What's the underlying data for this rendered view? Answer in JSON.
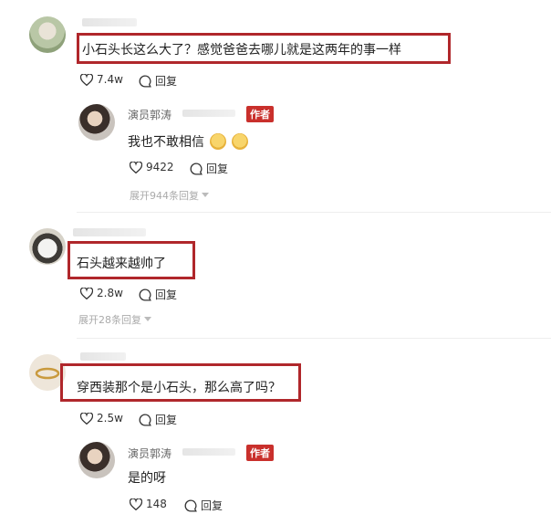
{
  "comments": [
    {
      "text": "小石头长这么大了？感觉爸爸去哪儿就是这两年的事一样",
      "likes": "7.4w",
      "reply_label": "回复",
      "replies": [
        {
          "author": "演员郭涛",
          "badge": "作者",
          "text": "我也不敢相信",
          "likes": "9422",
          "reply_label": "回复"
        }
      ],
      "expand_label": "展开944条回复"
    },
    {
      "text": "石头越来越帅了",
      "likes": "2.8w",
      "reply_label": "回复",
      "expand_label": "展开28条回复"
    },
    {
      "text": "穿西装那个是小石头，那么高了吗？",
      "likes": "2.5w",
      "reply_label": "回复",
      "replies": [
        {
          "author": "演员郭涛",
          "badge": "作者",
          "text": "是的呀",
          "likes": "148",
          "reply_label": "回复"
        }
      ]
    }
  ],
  "icons": {
    "like": "heart-outline-icon",
    "reply": "speech-bubble-icon",
    "expand": "caret-down-icon",
    "emoji": "clapping-emoji-icon"
  },
  "colors": {
    "highlight_box": "#b0272b",
    "author_badge": "#c9302c",
    "muted_text": "#aaaaaa"
  }
}
